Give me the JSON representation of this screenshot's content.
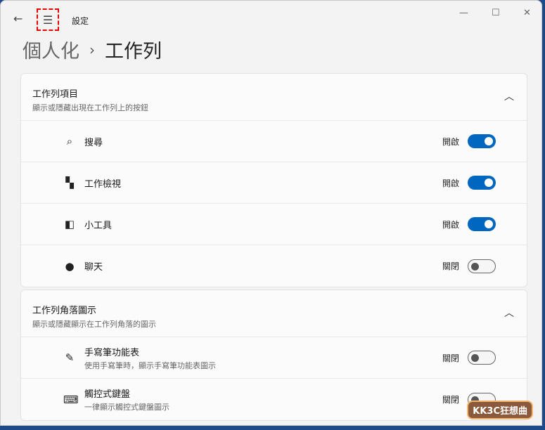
{
  "window": {
    "title": "設定",
    "controls": [
      "minimize",
      "maximize",
      "close"
    ]
  },
  "breadcrumb": {
    "parent": "個人化",
    "current": "工作列"
  },
  "sections": [
    {
      "title": "工作列項目",
      "subtitle": "顯示或隱藏出現在工作列上的按鈕",
      "items": [
        {
          "icon": "search-icon",
          "glyph": "⌕",
          "label": "搜尋",
          "state": "開啟",
          "on": true
        },
        {
          "icon": "task-view-icon",
          "glyph": "▚",
          "label": "工作檢視",
          "state": "開啟",
          "on": true
        },
        {
          "icon": "widgets-icon",
          "glyph": "◧",
          "label": "小工具",
          "state": "開啟",
          "on": true
        },
        {
          "icon": "chat-icon",
          "glyph": "●",
          "label": "聊天",
          "state": "關閉",
          "on": false
        }
      ]
    },
    {
      "title": "工作列角落圖示",
      "subtitle": "顯示或隱藏顯示在工作列角落的圖示",
      "items": [
        {
          "icon": "pen-icon",
          "glyph": "✎",
          "label": "手寫筆功能表",
          "sub": "使用手寫筆時，顯示手寫筆功能表圖示",
          "state": "關閉",
          "on": false
        },
        {
          "icon": "keyboard-icon",
          "glyph": "⌨",
          "label": "觸控式鍵盤",
          "sub": "一律顯示觸控式鍵盤圖示",
          "state": "關閉",
          "on": false
        }
      ]
    }
  ],
  "watermark": "KK3C狂想曲",
  "colors": {
    "accent": "#0067c0"
  }
}
